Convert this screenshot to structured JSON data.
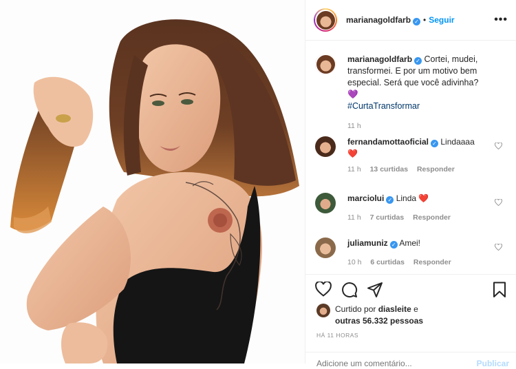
{
  "header": {
    "username": "marianagoldfarb",
    "verified_icon": "verified-badge-icon",
    "separator": "•",
    "follow_label": "Seguir",
    "more_label": "•••"
  },
  "caption": {
    "username": "marianagoldfarb",
    "text": "Cortei, mudei, transformei. E por um motivo bem especial. Será que você adivinha?",
    "emoji": "💜",
    "hashtag": "#CurtaTransformar",
    "time": "11 h"
  },
  "comments": [
    {
      "username": "fernandamottaoficial",
      "text": "Lindaaaa",
      "emoji": "❤️",
      "time": "11 h",
      "likes": "13 curtidas",
      "reply": "Responder"
    },
    {
      "username": "marciolui",
      "text": "Linda",
      "emoji": "❤️",
      "time": "11 h",
      "likes": "7 curtidas",
      "reply": "Responder"
    },
    {
      "username": "juliamuniz",
      "text": "Amei!",
      "emoji": "",
      "time": "10 h",
      "likes": "6 curtidas",
      "reply": "Responder"
    }
  ],
  "actions": {
    "icons": [
      "heart-icon",
      "comment-icon",
      "share-icon",
      "bookmark-icon"
    ]
  },
  "likes": {
    "prefix": "Curtido por",
    "user": "diasleite",
    "middle": "e",
    "others": "outras 56.332 pessoas"
  },
  "timestamp": "HÁ 11 HORAS",
  "add_comment": {
    "placeholder": "Adicione um comentário...",
    "publish_label": "Publicar"
  },
  "colors": {
    "accent": "#0095f6",
    "verified": "#3897f0",
    "heart_red": "#ed4956",
    "purple_heart": "#9b6fd6"
  }
}
